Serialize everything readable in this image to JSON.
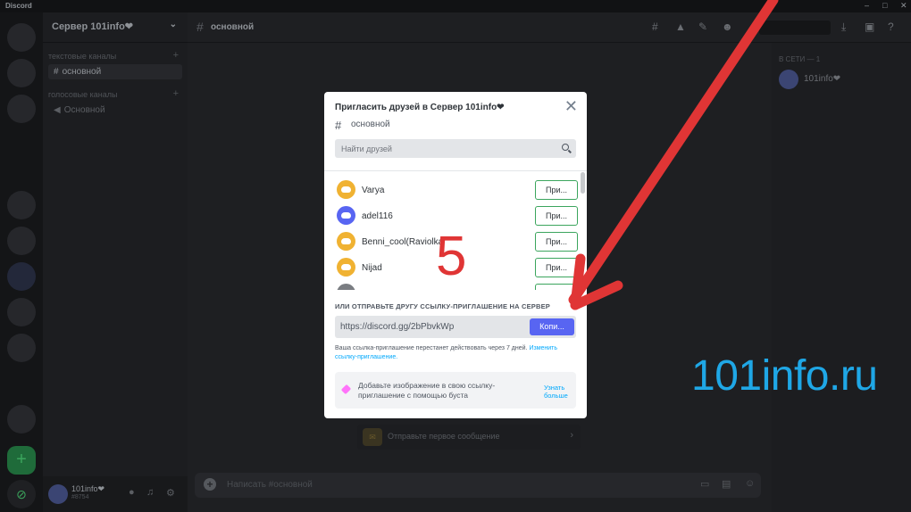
{
  "window": {
    "app_name": "Discord",
    "controls": [
      "–",
      "□",
      "✕"
    ]
  },
  "server": {
    "name": "Сервер 101info❤"
  },
  "sidebar": {
    "text_category": "текстовые каналы",
    "text_channel": "основной",
    "voice_category": "голосовые каналы",
    "voice_channel": "Основной"
  },
  "user_panel": {
    "name": "101info❤",
    "status": "#8754"
  },
  "topbar": {
    "channel_title": "основной"
  },
  "members": {
    "header": "В СЕТИ — 1",
    "member_name": "101info❤"
  },
  "welcome": {
    "text": "Отправьте первое сообщение"
  },
  "composer": {
    "placeholder": "Написать #основной"
  },
  "modal": {
    "title": "Пригласить друзей в Сервер 101info❤",
    "channel": "основной",
    "search_placeholder": "Найти друзей",
    "friends": [
      {
        "name": "Varya",
        "button": "При...",
        "avatar_color": "#f0b232"
      },
      {
        "name": "adel116",
        "button": "При...",
        "avatar_color": "#5865f2"
      },
      {
        "name": "Benni_cool(Raviolka",
        "button": "При...",
        "avatar_color": "#f0b232"
      },
      {
        "name": "Nijad",
        "button": "При...",
        "avatar_color": "#f0b232"
      }
    ],
    "link_label": "ИЛИ ОТПРАВЬТЕ ДРУГУ ССЫЛКУ-ПРИГЛАШЕНИЕ НА СЕРВЕР",
    "invite_link": "https://discord.gg/2bPbvkWp",
    "copy_button": "Копи...",
    "expiry_note": "Ваша ссылка-приглашение перестанет действовать через 7 дней.",
    "edit_link": "Изменить ссылку-приглашение.",
    "boost_text": "Добавьте изображение в свою ссылку-приглашение с помощью буста",
    "boost_learn_more": "Узнать больше"
  },
  "annotation": {
    "step_number": "5"
  },
  "watermark": "101info.ru",
  "colors": {
    "accent": "#5865f2",
    "arrow": "#e03535",
    "watermark": "#1fa7e6",
    "invite_outline": "#3ba55d"
  }
}
